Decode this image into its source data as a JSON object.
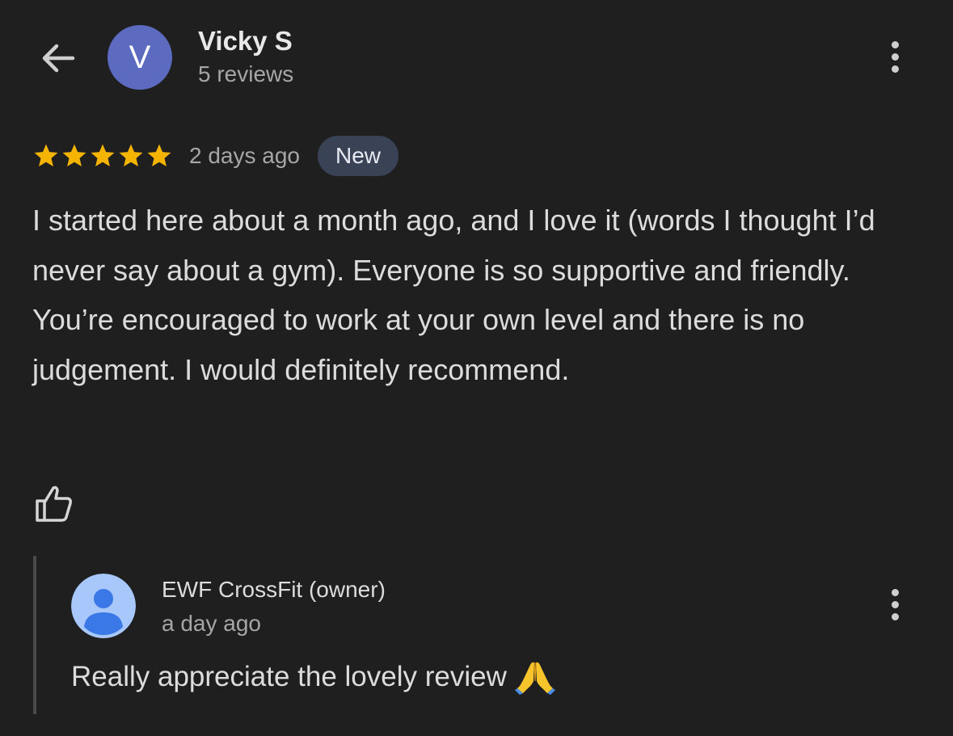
{
  "header": {
    "avatar_letter": "V",
    "avatar_color": "#5c6bc0",
    "reviewer_name": "Vicky S",
    "review_count": "5 reviews",
    "back_icon": "arrow-left-icon",
    "menu_icon": "more-vertical-icon"
  },
  "review": {
    "rating": 5,
    "rating_max": 5,
    "star_color": "#f5b400",
    "date": "2 days ago",
    "badge": "New",
    "text": "I started here about a month ago, and I love it (words I thought I’d never say about a gym). Everyone is so supportive and friendly. You’re encouraged to work at your own level and there is no judgement. I would definitely recommend.",
    "like_icon": "thumbs-up-icon"
  },
  "owner_reply": {
    "name": "EWF CrossFit (owner)",
    "date": "a day ago",
    "text": "Really appreciate the lovely review",
    "emoji_icon": "folded-hands-icon",
    "avatar_icon": "person-avatar-icon",
    "menu_icon": "more-vertical-icon"
  },
  "colors": {
    "background": "#1f1f1f",
    "badge_bg": "#3a4356",
    "owner_avatar_bg": "#a8c7fa",
    "owner_avatar_fg": "#3b78e7"
  }
}
